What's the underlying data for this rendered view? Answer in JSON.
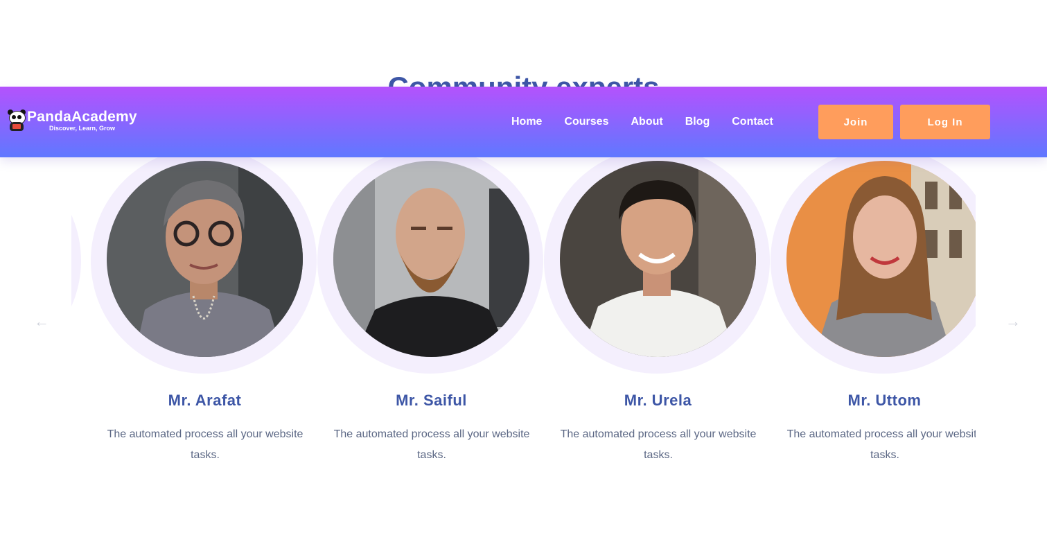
{
  "section": {
    "title": "Community experts"
  },
  "header": {
    "logo_name": "PandaAcademy",
    "logo_tagline": "Discover, Learn, Grow",
    "nav": [
      {
        "label": "Home"
      },
      {
        "label": "Courses"
      },
      {
        "label": "About"
      },
      {
        "label": "Blog"
      },
      {
        "label": "Contact"
      }
    ],
    "join_label": "Join",
    "login_label": "Log In"
  },
  "carousel": {
    "prev_icon": "arrow-left-icon",
    "next_icon": "arrow-right-icon",
    "prev_glyph": "←",
    "next_glyph": "→",
    "experts": [
      {
        "name": "Mr. Arafat",
        "description": "The automated process all your website tasks."
      },
      {
        "name": "Mr. Saiful",
        "description": "The automated process all your website tasks."
      },
      {
        "name": "Mr. Urela",
        "description": "The automated process all your website tasks."
      },
      {
        "name": "Mr. Uttom",
        "description": "The automated process all your website tasks."
      }
    ]
  },
  "colors": {
    "header_gradient_top": "#b452fd",
    "header_gradient_bottom": "#5f78ff",
    "button": "#ff9d5c",
    "heading": "#3d56a6",
    "ring": "#f4effd"
  }
}
